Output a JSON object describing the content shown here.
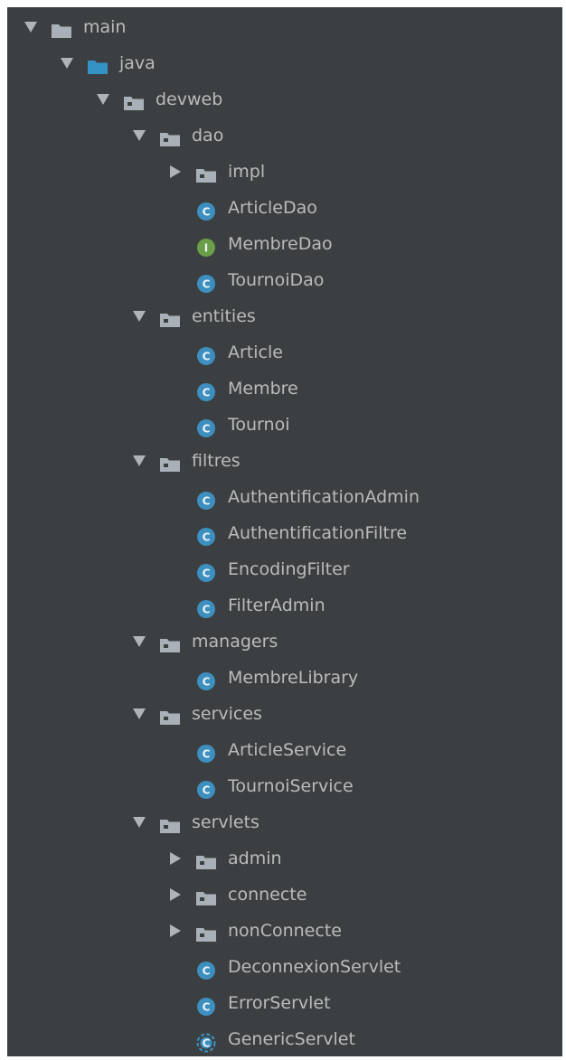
{
  "colors": {
    "panel_bg": "#3c3f41",
    "text": "#bbbbbb",
    "folder": "#a9b0b8",
    "source_folder": "#3592c4",
    "class_icon": "#3d8fbf",
    "interface_icon": "#6a9e48",
    "arrow": "#b0b4b8"
  },
  "tree": [
    {
      "label": "main",
      "level": 0,
      "arrow": "down",
      "icon": "folder-icon"
    },
    {
      "label": "java",
      "level": 1,
      "arrow": "down",
      "icon": "source-folder-icon"
    },
    {
      "label": "devweb",
      "level": 2,
      "arrow": "down",
      "icon": "package-icon"
    },
    {
      "label": "dao",
      "level": 3,
      "arrow": "down",
      "icon": "package-icon"
    },
    {
      "label": "impl",
      "level": 4,
      "arrow": "right",
      "icon": "package-icon"
    },
    {
      "label": "ArticleDao",
      "level": 4,
      "arrow": "none",
      "icon": "class-icon",
      "badge": "C"
    },
    {
      "label": "MembreDao",
      "level": 4,
      "arrow": "none",
      "icon": "interface-icon",
      "badge": "I"
    },
    {
      "label": "TournoiDao",
      "level": 4,
      "arrow": "none",
      "icon": "class-icon",
      "badge": "C"
    },
    {
      "label": "entities",
      "level": 3,
      "arrow": "down",
      "icon": "package-icon"
    },
    {
      "label": "Article",
      "level": 4,
      "arrow": "none",
      "icon": "class-icon",
      "badge": "C"
    },
    {
      "label": "Membre",
      "level": 4,
      "arrow": "none",
      "icon": "class-icon",
      "badge": "C"
    },
    {
      "label": "Tournoi",
      "level": 4,
      "arrow": "none",
      "icon": "class-icon",
      "badge": "C"
    },
    {
      "label": "filtres",
      "level": 3,
      "arrow": "down",
      "icon": "package-icon"
    },
    {
      "label": "AuthentificationAdmin",
      "level": 4,
      "arrow": "none",
      "icon": "class-icon",
      "badge": "C"
    },
    {
      "label": "AuthentificationFiltre",
      "level": 4,
      "arrow": "none",
      "icon": "class-icon",
      "badge": "C"
    },
    {
      "label": "EncodingFilter",
      "level": 4,
      "arrow": "none",
      "icon": "class-icon",
      "badge": "C"
    },
    {
      "label": "FilterAdmin",
      "level": 4,
      "arrow": "none",
      "icon": "class-icon",
      "badge": "C"
    },
    {
      "label": "managers",
      "level": 3,
      "arrow": "down",
      "icon": "package-icon"
    },
    {
      "label": "MembreLibrary",
      "level": 4,
      "arrow": "none",
      "icon": "class-icon",
      "badge": "C"
    },
    {
      "label": "services",
      "level": 3,
      "arrow": "down",
      "icon": "package-icon"
    },
    {
      "label": "ArticleService",
      "level": 4,
      "arrow": "none",
      "icon": "class-icon",
      "badge": "C"
    },
    {
      "label": "TournoiService",
      "level": 4,
      "arrow": "none",
      "icon": "class-icon",
      "badge": "C"
    },
    {
      "label": "servlets",
      "level": 3,
      "arrow": "down",
      "icon": "package-icon"
    },
    {
      "label": "admin",
      "level": 4,
      "arrow": "right",
      "icon": "package-icon"
    },
    {
      "label": "connecte",
      "level": 4,
      "arrow": "right",
      "icon": "package-icon"
    },
    {
      "label": "nonConnecte",
      "level": 4,
      "arrow": "right",
      "icon": "package-icon"
    },
    {
      "label": "DeconnexionServlet",
      "level": 4,
      "arrow": "none",
      "icon": "class-icon",
      "badge": "C"
    },
    {
      "label": "ErrorServlet",
      "level": 4,
      "arrow": "none",
      "icon": "class-icon",
      "badge": "C"
    },
    {
      "label": "GenericServlet",
      "level": 4,
      "arrow": "none",
      "icon": "abstract-class-icon",
      "badge": "C"
    }
  ]
}
